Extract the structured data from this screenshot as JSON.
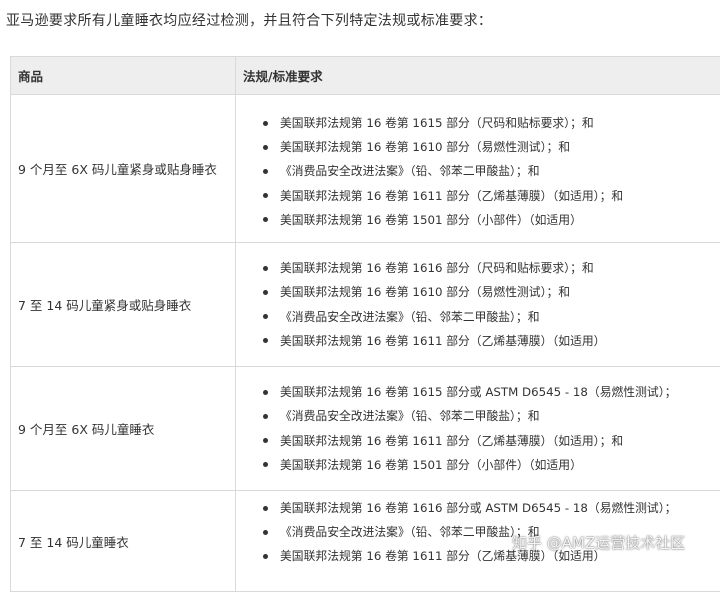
{
  "intro": "亚马逊要求所有儿童睡衣均应经过检测，并且符合下列特定法规或标准要求：",
  "table": {
    "headers": [
      "商品",
      "法规/标准要求"
    ],
    "rows": [
      {
        "product": "9 个月至 6X 码儿童紧身或贴身睡衣",
        "items": [
          "美国联邦法规第 16 卷第 1615 部分（尺码和贴标要求）；和",
          "美国联邦法规第 16 卷第 1610 部分（易燃性测试）；和",
          "《消费品安全改进法案》（铅、邻苯二甲酸盐）；和",
          "美国联邦法规第 16 卷第 1611 部分（乙烯基薄膜）（如适用）；和",
          "美国联邦法规第 16 卷第 1501 部分（小部件）（如适用）"
        ]
      },
      {
        "product": "7 至 14 码儿童紧身或贴身睡衣",
        "items": [
          "美国联邦法规第 16 卷第 1616 部分（尺码和贴标要求）；和",
          "美国联邦法规第 16 卷第 1610 部分（易燃性测试）；和",
          "《消费品安全改进法案》（铅、邻苯二甲酸盐）；和",
          "美国联邦法规第 16 卷第 1611 部分（乙烯基薄膜）（如适用）"
        ]
      },
      {
        "product": "9 个月至 6X 码儿童睡衣",
        "items": [
          "美国联邦法规第 16 卷第 1615 部分或 ASTM D6545 - 18（易燃性测试）；",
          "《消费品安全改进法案》（铅、邻苯二甲酸盐）；和",
          "美国联邦法规第 16 卷第 1611 部分（乙烯基薄膜）（如适用）；和",
          "美国联邦法规第 16 卷第 1501 部分（小部件）（如适用）"
        ]
      },
      {
        "product": "7 至 14 码儿童睡衣",
        "items": [
          "美国联邦法规第 16 卷第 1616 部分或 ASTM D6545 - 18（易燃性测试）；",
          "《消费品安全改进法案》（铅、邻苯二甲酸盐）；和",
          "美国联邦法规第 16 卷第 1611 部分（乙烯基薄膜）（如适用）"
        ]
      }
    ]
  },
  "watermark": "知乎 @AMZ运营技术社区"
}
